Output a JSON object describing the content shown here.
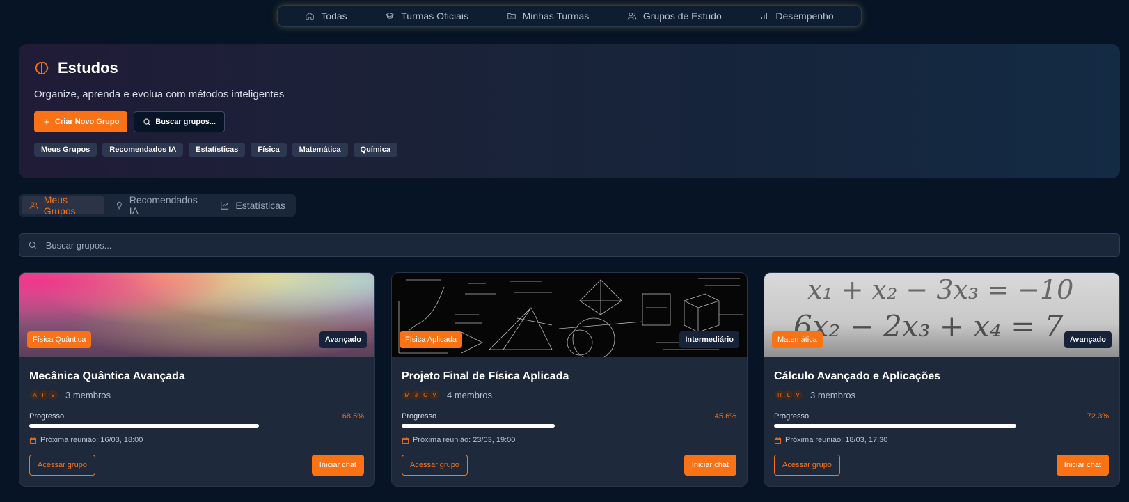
{
  "topnav": {
    "items": [
      {
        "label": "Todas",
        "icon": "home-icon"
      },
      {
        "label": "Turmas Oficiais",
        "icon": "graduation-cap-icon"
      },
      {
        "label": "Minhas Turmas",
        "icon": "folder-icon"
      },
      {
        "label": "Grupos de Estudo",
        "icon": "users-icon"
      },
      {
        "label": "Desempenho",
        "icon": "bar-chart-icon"
      }
    ]
  },
  "hero": {
    "title": "Estudos",
    "icon": "brain-icon",
    "subtitle": "Organize, aprenda e evolua com métodos inteligentes",
    "create_button": "Criar Novo Grupo",
    "search_button": "Buscar grupos...",
    "tags": [
      "Meus Grupos",
      "Recomendados IA",
      "Estatísticas",
      "Física",
      "Matemática",
      "Química"
    ]
  },
  "tabs": [
    {
      "label": "Meus Grupos",
      "icon": "users-icon",
      "active": true
    },
    {
      "label": "Recomendados IA",
      "icon": "lightbulb-icon",
      "active": false
    },
    {
      "label": "Estatísticas",
      "icon": "line-chart-icon",
      "active": false
    }
  ],
  "search": {
    "placeholder": "Buscar grupos..."
  },
  "cards": [
    {
      "category": "Física Quântica",
      "level": "Avançado",
      "title": "Mecânica Quântica Avançada",
      "avatars": [
        "A",
        "P",
        "V"
      ],
      "members": "3 membros",
      "progress_label": "Progresso",
      "progress_value": "68.5%",
      "progress": 0.685,
      "meeting": "Próxima reunião: 16/03, 18:00",
      "access_label": "Acessar grupo",
      "chat_label": "Iniciar chat"
    },
    {
      "category": "Física Aplicada",
      "level": "Intermediário",
      "title": "Projeto Final de Física Aplicada",
      "avatars": [
        "M",
        "J",
        "C",
        "V"
      ],
      "members": "4 membros",
      "progress_label": "Progresso",
      "progress_value": "45.6%",
      "progress": 0.456,
      "meeting": "Próxima reunião: 23/03, 19:00",
      "access_label": "Acessar grupo",
      "chat_label": "Iniciar chat"
    },
    {
      "category": "Matemática",
      "level": "Avançado",
      "title": "Cálculo Avançado e Aplicações",
      "avatars": [
        "R",
        "L",
        "V"
      ],
      "members": "3 membros",
      "progress_label": "Progresso",
      "progress_value": "72.3%",
      "progress": 0.723,
      "meeting": "Próxima reunião: 18/03, 17:30",
      "access_label": "Acessar grupo",
      "chat_label": "Iniciar chat"
    }
  ],
  "card3_image": {
    "line1": "x₁ + x₂ − 3x₃ = −10",
    "line2": "6x₂ − 2x₃ + x₄ = 7"
  },
  "colors": {
    "accent": "#f97316",
    "background": "#061426",
    "card": "#1e293b"
  }
}
